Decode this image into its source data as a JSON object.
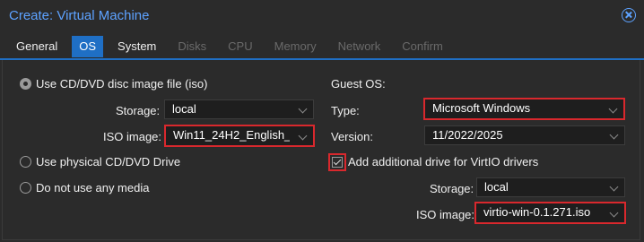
{
  "dialog": {
    "title": "Create: Virtual Machine"
  },
  "tabs": [
    {
      "label": "General"
    },
    {
      "label": "OS"
    },
    {
      "label": "System"
    },
    {
      "label": "Disks"
    },
    {
      "label": "CPU"
    },
    {
      "label": "Memory"
    },
    {
      "label": "Network"
    },
    {
      "label": "Confirm"
    }
  ],
  "media": {
    "use_iso_label": "Use CD/DVD disc image file (iso)",
    "storage_label": "Storage:",
    "storage_value": "local",
    "iso_image_label": "ISO image:",
    "iso_image_value": "Win11_24H2_English_",
    "use_physical_label": "Use physical CD/DVD Drive",
    "no_media_label": "Do not use any media"
  },
  "guest_os": {
    "heading": "Guest OS:",
    "type_label": "Type:",
    "type_value": "Microsoft Windows",
    "version_label": "Version:",
    "version_value": "11/2022/2025",
    "virtio_label": "Add additional drive for VirtIO drivers",
    "virtio_checked": true,
    "storage_label": "Storage:",
    "storage_value": "local",
    "iso_image_label": "ISO image:",
    "iso_image_value": "virtio-win-0.1.271.iso"
  },
  "colors": {
    "accent": "#1f6fc5",
    "highlight": "#d9282d",
    "title": "#5da2ff"
  }
}
